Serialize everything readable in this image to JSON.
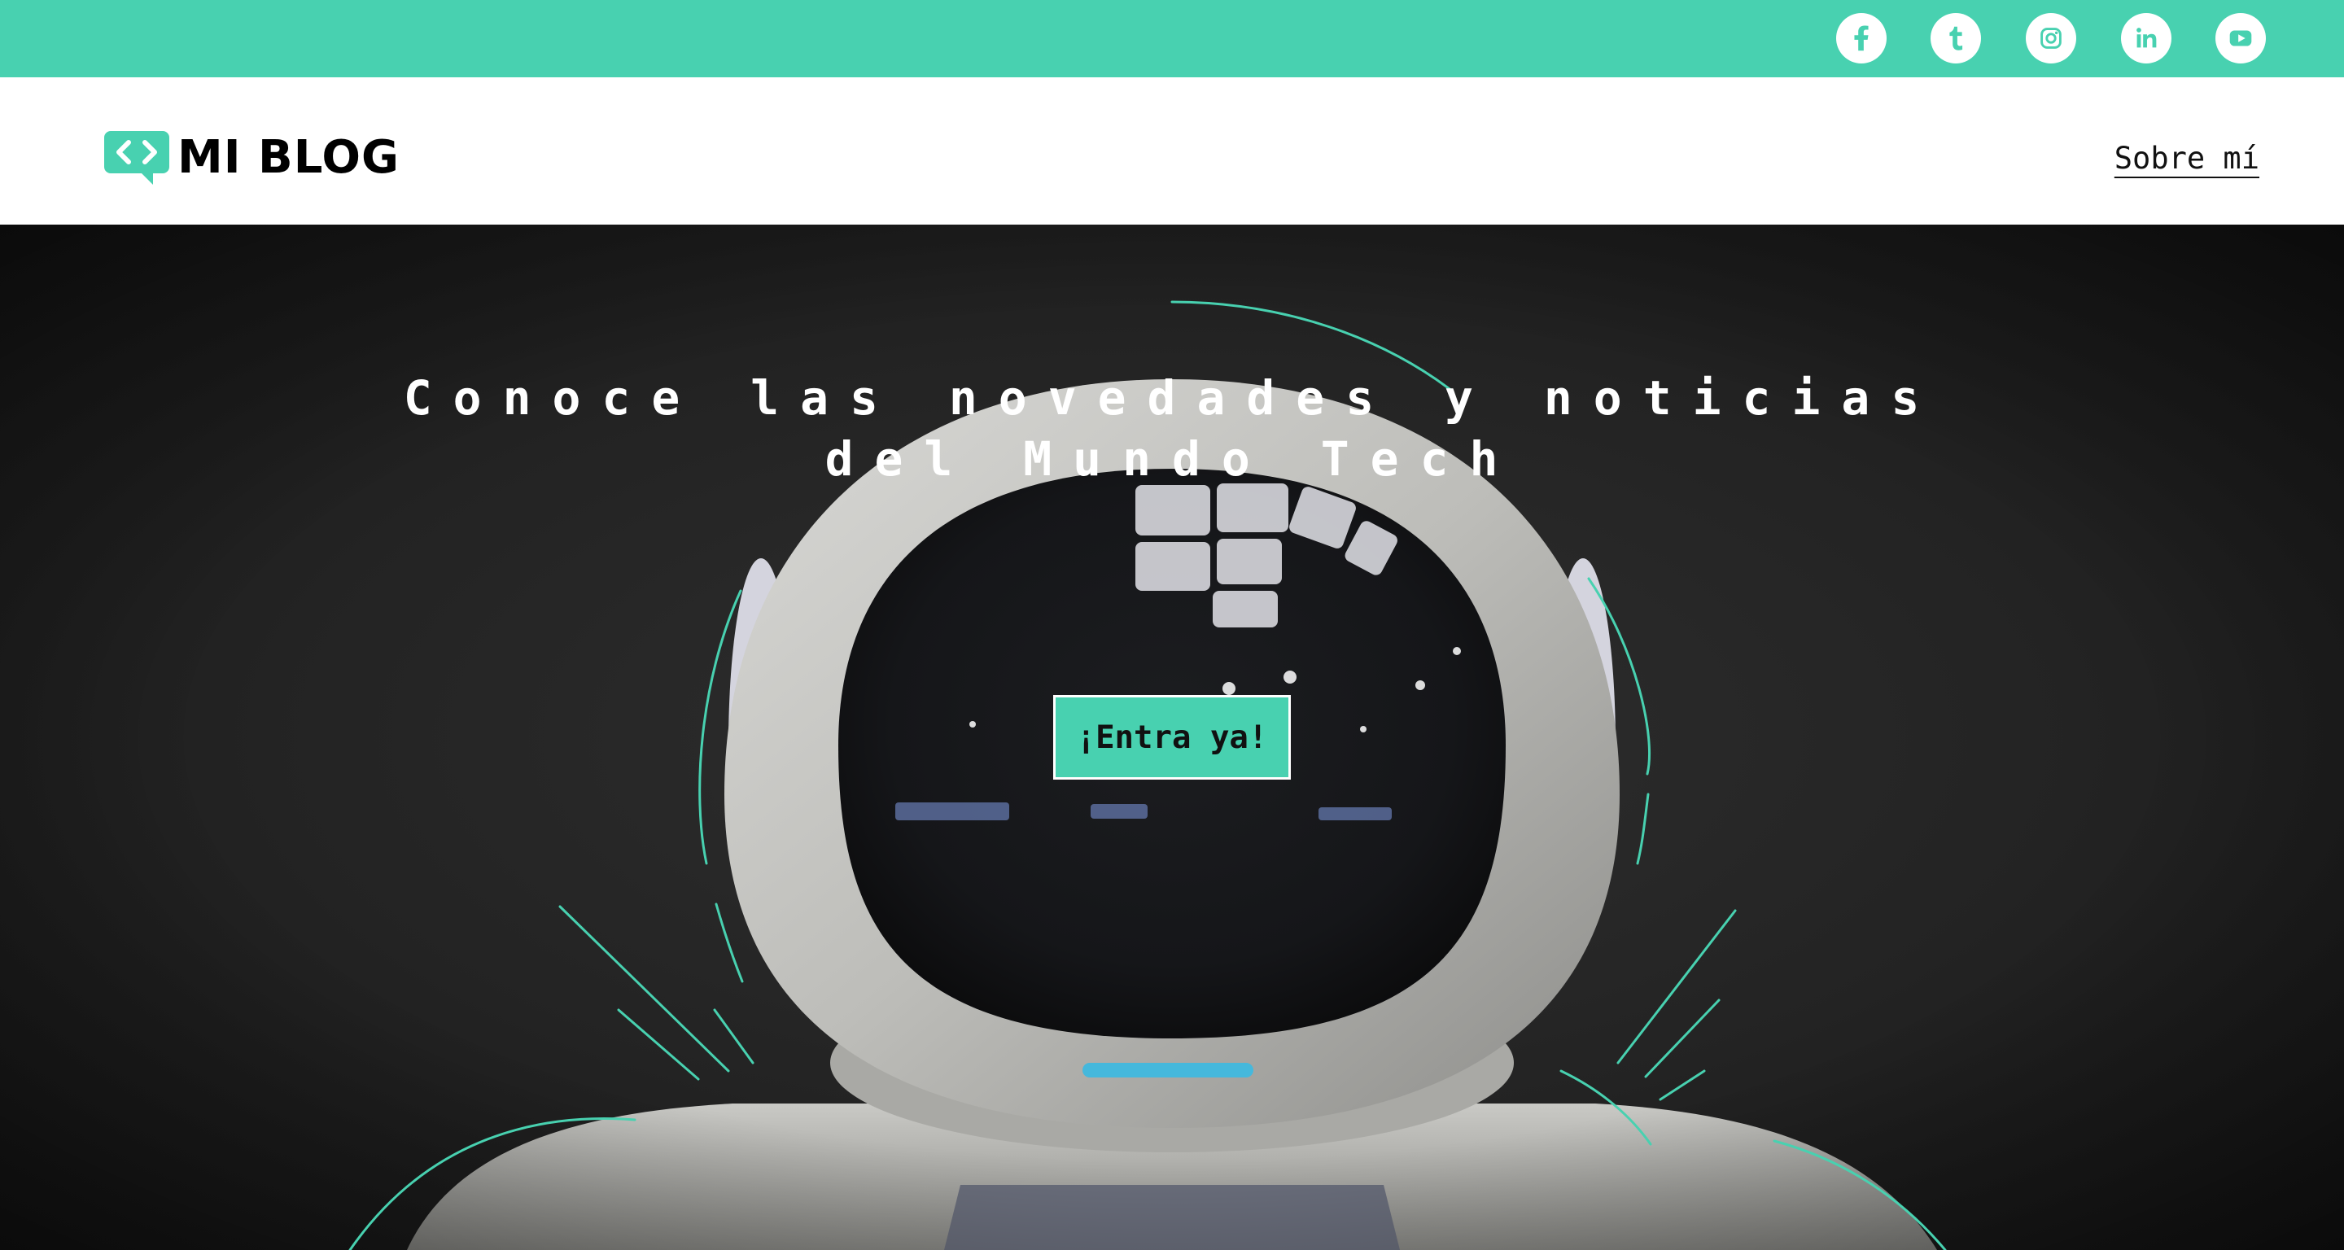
{
  "colors": {
    "accent": "#48d1b0",
    "topbar": "#48d1b0",
    "nav_background": "#ffffff",
    "hero_background": "#232323",
    "text_dark": "#111111",
    "text_light": "#ffffff"
  },
  "topbar": {
    "social": [
      {
        "name": "facebook-icon"
      },
      {
        "name": "tumblr-icon"
      },
      {
        "name": "instagram-icon"
      },
      {
        "name": "linkedin-icon"
      },
      {
        "name": "youtube-icon"
      }
    ]
  },
  "header": {
    "logo_text": "MI BLOG",
    "logo_icon": "code-chat-bubble-icon",
    "nav_link": "Sobre mí"
  },
  "hero": {
    "title_line1": "Conoce las novedades y noticias",
    "title_line2": "del Mundo Tech",
    "cta_label": "¡Entra ya!",
    "background": "robot-astronaut-photo"
  }
}
